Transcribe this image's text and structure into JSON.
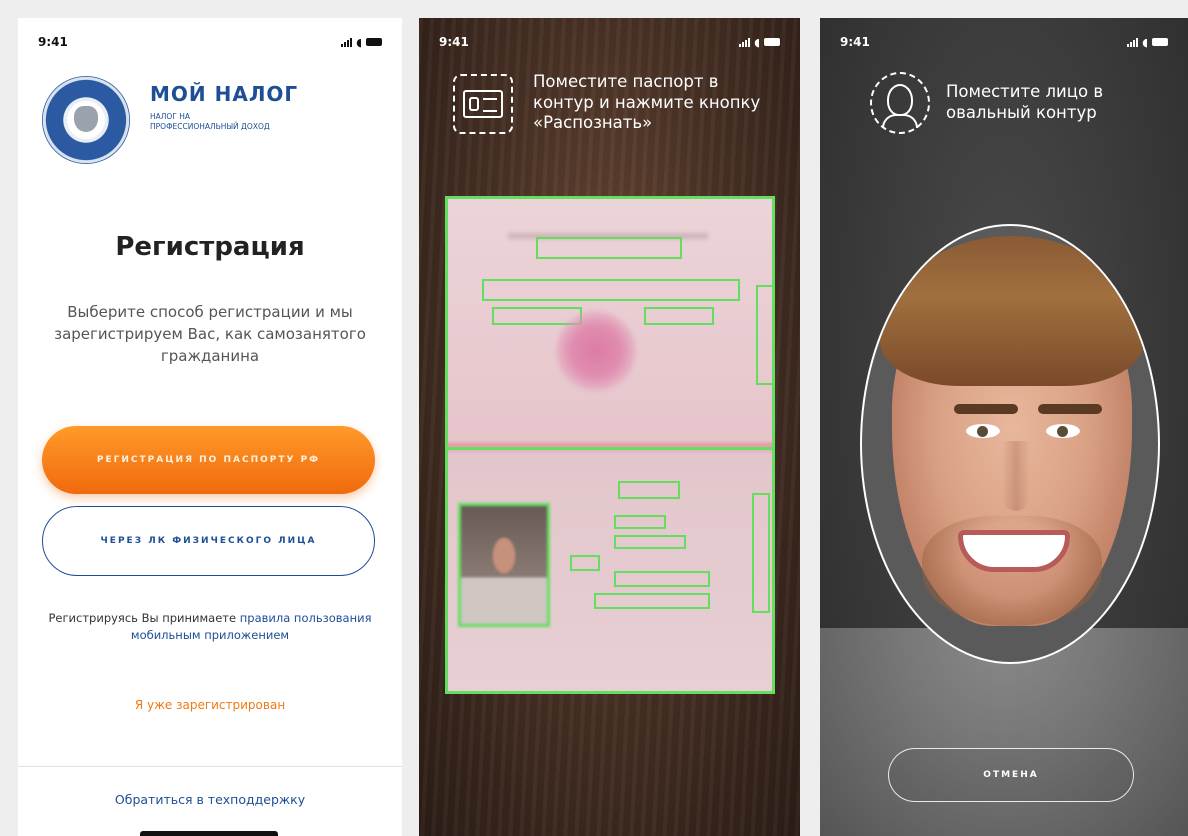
{
  "status_time": "9:41",
  "screen_register": {
    "brand_title": "МОЙ НАЛОГ",
    "brand_subtitle": "НАЛОГ НА ПРОФЕССИОНАЛЬНЫЙ ДОХОД",
    "title": "Регистрация",
    "description": "Выберите способ регистрации и мы зарегистрируем Вас, как самозанятого гражданина",
    "passport_button": "РЕГИСТРАЦИЯ ПО ПАСПОРТУ РФ",
    "lk_button": "ЧЕРЕЗ ЛК ФИЗИЧЕСКОГО ЛИЦА",
    "terms_prefix": "Регистрируясь Вы принимаете",
    "terms_link": "правила пользования мобильным приложением",
    "already_registered": "Я уже зарегистрирован",
    "support_link": "Обратиться в техподдержку"
  },
  "screen_passport": {
    "instruction": "Поместите паспорт в контур и нажмите кнопку «Распознать»"
  },
  "screen_face": {
    "instruction": "Поместите лицо в овальный контур",
    "cancel_button": "ОТМЕНА"
  },
  "colors": {
    "accent_orange": "#f07a16",
    "brand_blue": "#1d4e96",
    "scan_green": "#5fe05a"
  }
}
